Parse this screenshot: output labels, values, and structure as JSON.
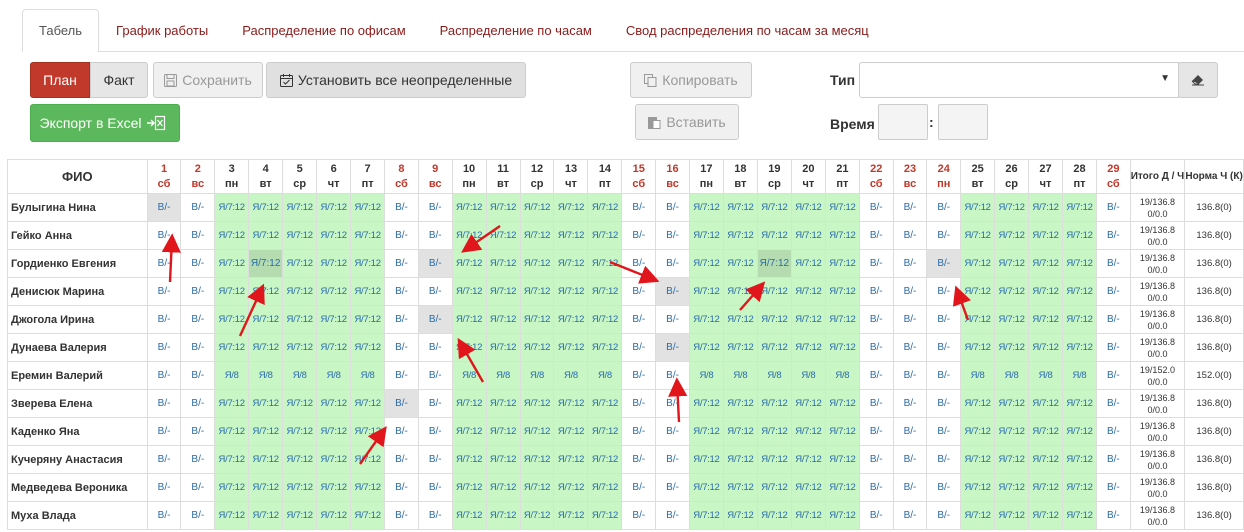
{
  "tabs": [
    {
      "label": "Табель",
      "active": true
    },
    {
      "label": "График работы",
      "active": false
    },
    {
      "label": "Распределение по офисам",
      "active": false
    },
    {
      "label": "Распределение по часам",
      "active": false
    },
    {
      "label": "Свод распределения по часам за месяц",
      "active": false
    }
  ],
  "toolbar": {
    "plan": "План",
    "fact": "Факт",
    "save": "Сохранить",
    "set_all": "Установить все неопределенные",
    "export": "Экспорт в Excel",
    "copy": "Копировать",
    "paste": "Вставить",
    "type_label": "Тип",
    "time_label": "Время",
    "time_sep": ":",
    "type_value": "",
    "time_hours": "",
    "time_minutes": ""
  },
  "colors": {
    "accent_red": "#c0392b",
    "work_green": "#c8f7c5",
    "excel_green": "#5cb85c",
    "weekend_red": "#c0392b"
  },
  "icons": {
    "save": "floppy-disk-icon",
    "set_all": "calendar-check-icon",
    "export": "excel-export-icon",
    "copy": "copy-icon",
    "paste": "paste-icon",
    "eraser": "eraser-icon",
    "caret": "chevron-down-icon"
  },
  "table": {
    "name_header": "ФИО",
    "total_header": "Итого Д / Ч",
    "norm_header": "Норма Ч (К)",
    "days": [
      {
        "n": "1",
        "d": "сб",
        "weekend": true
      },
      {
        "n": "2",
        "d": "вс",
        "weekend": true
      },
      {
        "n": "3",
        "d": "пн",
        "weekend": false
      },
      {
        "n": "4",
        "d": "вт",
        "weekend": false
      },
      {
        "n": "5",
        "d": "ср",
        "weekend": false
      },
      {
        "n": "6",
        "d": "чт",
        "weekend": false
      },
      {
        "n": "7",
        "d": "пт",
        "weekend": false
      },
      {
        "n": "8",
        "d": "сб",
        "weekend": true
      },
      {
        "n": "9",
        "d": "вс",
        "weekend": true
      },
      {
        "n": "10",
        "d": "пн",
        "weekend": false
      },
      {
        "n": "11",
        "d": "вт",
        "weekend": false
      },
      {
        "n": "12",
        "d": "ср",
        "weekend": false
      },
      {
        "n": "13",
        "d": "чт",
        "weekend": false
      },
      {
        "n": "14",
        "d": "пт",
        "weekend": false
      },
      {
        "n": "15",
        "d": "сб",
        "weekend": true
      },
      {
        "n": "16",
        "d": "вс",
        "weekend": true
      },
      {
        "n": "17",
        "d": "пн",
        "weekend": false
      },
      {
        "n": "18",
        "d": "вт",
        "weekend": false
      },
      {
        "n": "19",
        "d": "ср",
        "weekend": false
      },
      {
        "n": "20",
        "d": "чт",
        "weekend": false
      },
      {
        "n": "21",
        "d": "пт",
        "weekend": false
      },
      {
        "n": "22",
        "d": "сб",
        "weekend": true
      },
      {
        "n": "23",
        "d": "вс",
        "weekend": true
      },
      {
        "n": "24",
        "d": "пн",
        "weekend": true
      },
      {
        "n": "25",
        "d": "вт",
        "weekend": false
      },
      {
        "n": "26",
        "d": "ср",
        "weekend": false
      },
      {
        "n": "27",
        "d": "чт",
        "weekend": false
      },
      {
        "n": "28",
        "d": "пт",
        "weekend": false
      },
      {
        "n": "29",
        "d": "сб",
        "weekend": true
      }
    ],
    "off_value": "В/-",
    "rows": [
      {
        "name": "Булыгина Нина",
        "work": "Я/7:12",
        "total": "19/136.8 0/0.0",
        "norm": "136.8(0)",
        "sel": [
          1
        ],
        "selw": []
      },
      {
        "name": "Гейко Анна",
        "work": "Я/7:12",
        "total": "19/136.8 0/0.0",
        "norm": "136.8(0)",
        "sel": [],
        "selw": []
      },
      {
        "name": "Гордиенко Евгения",
        "work": "Я/7:12",
        "total": "19/136.8 0/0.0",
        "norm": "136.8(0)",
        "sel": [
          9,
          24
        ],
        "selw": [
          4,
          19
        ]
      },
      {
        "name": "Денисюк Марина",
        "work": "Я/7:12",
        "total": "19/136.8 0/0.0",
        "norm": "136.8(0)",
        "sel": [
          16
        ],
        "selw": []
      },
      {
        "name": "Джогола Ирина",
        "work": "Я/7:12",
        "total": "19/136.8 0/0.0",
        "norm": "136.8(0)",
        "sel": [
          9
        ],
        "selw": []
      },
      {
        "name": "Дунаева Валерия",
        "work": "Я/7:12",
        "total": "19/136.8 0/0.0",
        "norm": "136.8(0)",
        "sel": [
          16
        ],
        "selw": []
      },
      {
        "name": "Еремин Валерий",
        "work": "Я/8",
        "total": "19/152.0 0/0.0",
        "norm": "152.0(0)",
        "sel": [],
        "selw": []
      },
      {
        "name": "Зверева Елена",
        "work": "Я/7:12",
        "total": "19/136.8 0/0.0",
        "norm": "136.8(0)",
        "sel": [
          8
        ],
        "selw": []
      },
      {
        "name": "Каденко Яна",
        "work": "Я/7:12",
        "total": "19/136.8 0/0.0",
        "norm": "136.8(0)",
        "sel": [],
        "selw": []
      },
      {
        "name": "Кучеряну Анастасия",
        "work": "Я/7:12",
        "total": "19/136.8 0/0.0",
        "norm": "136.8(0)",
        "sel": [],
        "selw": []
      },
      {
        "name": "Медведева Вероника",
        "work": "Я/7:12",
        "total": "19/136.8 0/0.0",
        "norm": "136.8(0)",
        "sel": [],
        "selw": []
      },
      {
        "name": "Муха Влада",
        "work": "Я/7:12",
        "total": "19/136.8 0/0.0",
        "norm": "136.8(0)",
        "sel": [],
        "selw": []
      }
    ]
  }
}
